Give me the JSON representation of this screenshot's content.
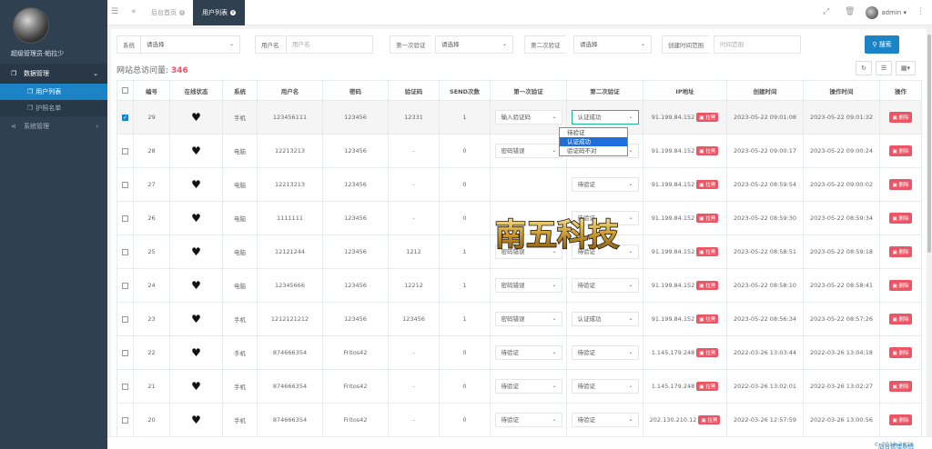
{
  "sidebar": {
    "profile_name": "超级管理员·帕拉少",
    "menu": [
      {
        "label": "数据管理",
        "icon": "copy-icon"
      },
      {
        "label": "系统管理",
        "icon": "share-icon"
      }
    ],
    "submenu": [
      {
        "label": "用户列表",
        "active": true
      },
      {
        "label": "护照名单",
        "active": false
      }
    ]
  },
  "topbar": {
    "tabs": [
      {
        "label": "后台首页"
      },
      {
        "label": "用户列表"
      }
    ],
    "user": "admin"
  },
  "filters": {
    "system_label": "系统",
    "system_value": "请选择",
    "username_label": "用户名",
    "username_placeholder": "用户名",
    "first_verify_label": "第一次验证",
    "first_verify_value": "请选择",
    "second_verify_label": "第二次验证",
    "second_verify_value": "请选择",
    "created_label": "创建时间范围",
    "created_placeholder": "时间范围",
    "search_button": "搜索"
  },
  "visits": {
    "label": "网站总访问量:",
    "count": "346"
  },
  "table": {
    "headers": [
      "编号",
      "在线状态",
      "系统",
      "用户名",
      "密码",
      "验证码",
      "SEND次数",
      "第一次验证",
      "第二次验证",
      "IP地址",
      "创建时间",
      "操作时间",
      "操作"
    ],
    "ban_label": "拉黑",
    "delete_label": "删除",
    "rows": [
      {
        "id": "29",
        "system": "手机",
        "username": "123456111",
        "password": "123456",
        "code": "12331",
        "send": "1",
        "v1": "输入验证码",
        "v2": "认证成功",
        "ip": "91.199.84.152",
        "created": "2023-05-22 09:01:08",
        "updated": "2023-05-22 09:01:32"
      },
      {
        "id": "28",
        "system": "电脑",
        "username": "12213213",
        "password": "123456",
        "code": "-",
        "send": "0",
        "v1": "密码错误",
        "v2": "待验证",
        "ip": "91.199.84.152",
        "created": "2023-05-22 09:00:17",
        "updated": "2023-05-22 09:00:24"
      },
      {
        "id": "27",
        "system": "电脑",
        "username": "12213213",
        "password": "123456",
        "code": "-",
        "send": "0",
        "v1": "",
        "v2": "待验证",
        "ip": "91.199.84.152",
        "created": "2023-05-22 08:59:54",
        "updated": "2023-05-22 09:00:02"
      },
      {
        "id": "26",
        "system": "电脑",
        "username": "1111111",
        "password": "123456",
        "code": "-",
        "send": "0",
        "v1": "",
        "v2": "待验证",
        "ip": "91.199.84.152",
        "created": "2023-05-22 08:59:30",
        "updated": "2023-05-22 08:59:34"
      },
      {
        "id": "25",
        "system": "电脑",
        "username": "12121244",
        "password": "123456",
        "code": "1212",
        "send": "1",
        "v1": "密码错误",
        "v2": "待验证",
        "ip": "91.199.84.152",
        "created": "2023-05-22 08:58:51",
        "updated": "2023-05-22 08:59:18"
      },
      {
        "id": "24",
        "system": "电脑",
        "username": "12345666",
        "password": "123456",
        "code": "12212",
        "send": "1",
        "v1": "密码错误",
        "v2": "待验证",
        "ip": "91.199.84.152",
        "created": "2023-05-22 08:58:10",
        "updated": "2023-05-22 08:58:41"
      },
      {
        "id": "23",
        "system": "手机",
        "username": "1212121212",
        "password": "123456",
        "code": "123456",
        "send": "1",
        "v1": "密码错误",
        "v2": "认证成功",
        "ip": "91.199.84.152",
        "created": "2023-05-22 08:56:34",
        "updated": "2023-05-22 08:57:26"
      },
      {
        "id": "22",
        "system": "手机",
        "username": "874666354",
        "password": "Fritos42",
        "code": "-",
        "send": "0",
        "v1": "待验证",
        "v2": "待验证",
        "ip": "1.145.179.248",
        "created": "2022-03-26 13:03:44",
        "updated": "2022-03-26 13:04:18"
      },
      {
        "id": "21",
        "system": "手机",
        "username": "874666354",
        "password": "Fritos42",
        "code": "-",
        "send": "0",
        "v1": "待验证",
        "v2": "待验证",
        "ip": "1.145.179.248",
        "created": "2022-03-26 13:02:01",
        "updated": "2022-03-26 13:02:27"
      },
      {
        "id": "20",
        "system": "手机",
        "username": "874666354",
        "password": "Fritos42",
        "code": "-",
        "send": "0",
        "v1": "待验证",
        "v2": "待验证",
        "ip": "202.130.210.12",
        "created": "2022-03-26 12:57:59",
        "updated": "2022-03-26 13:00:56"
      }
    ]
  },
  "dropdown": {
    "options": [
      "待验证",
      "认证成功",
      "验证码不对"
    ],
    "highlighted": 1
  },
  "logo_text": "南五科技",
  "footer": {
    "copyright": "© 2018-2026",
    "link": "后台管理系统"
  },
  "colors": {
    "sidebar_bg": "#2f4050",
    "accent_blue": "#1c84c6",
    "danger_red": "#ed5565"
  }
}
